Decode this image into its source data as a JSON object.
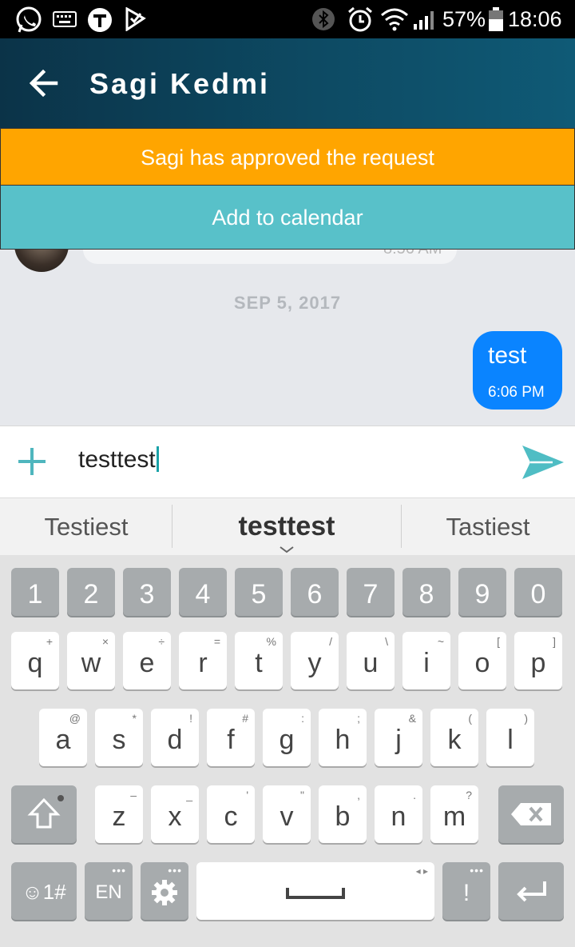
{
  "status_bar": {
    "battery_text": "57%",
    "time": "18:06",
    "icons": [
      "whatsapp-icon",
      "keyboard-icon",
      "app-t-icon",
      "check-flag-icon",
      "bluetooth-icon",
      "alarm-icon",
      "wifi-icon",
      "signal-icon",
      "battery-icon"
    ]
  },
  "header": {
    "title": "Sagi Kedmi",
    "back_icon": "arrow-left-icon",
    "bg": "#0d4a63"
  },
  "banners": {
    "approved": "Sagi has approved the request",
    "approved_color": "#ffa500",
    "calendar": "Add to calendar",
    "calendar_color": "#58c1c9"
  },
  "chat": {
    "previous_time_partial": "8:56 AM",
    "date_separator": "SEP 5, 2017",
    "messages": [
      {
        "text": "test",
        "time": "6:06 PM",
        "sent": true,
        "color": "#0a84ff"
      }
    ]
  },
  "composer": {
    "value": "testtest",
    "plus_icon": "plus-icon",
    "send_icon": "send-icon"
  },
  "keyboard": {
    "suggestions": [
      "Testiest",
      "testtest",
      "Tastiest"
    ],
    "numbers": [
      "1",
      "2",
      "3",
      "4",
      "5",
      "6",
      "7",
      "8",
      "9",
      "0"
    ],
    "row1": [
      {
        "k": "q",
        "h": "+"
      },
      {
        "k": "w",
        "h": "×"
      },
      {
        "k": "e",
        "h": "÷"
      },
      {
        "k": "r",
        "h": "="
      },
      {
        "k": "t",
        "h": "%"
      },
      {
        "k": "y",
        "h": "/"
      },
      {
        "k": "u",
        "h": "\\"
      },
      {
        "k": "i",
        "h": "~"
      },
      {
        "k": "o",
        "h": "["
      },
      {
        "k": "p",
        "h": "]"
      }
    ],
    "row2": [
      {
        "k": "a",
        "h": "@"
      },
      {
        "k": "s",
        "h": "*"
      },
      {
        "k": "d",
        "h": "!"
      },
      {
        "k": "f",
        "h": "#"
      },
      {
        "k": "g",
        "h": ":"
      },
      {
        "k": "h",
        "h": ";"
      },
      {
        "k": "j",
        "h": "&"
      },
      {
        "k": "k",
        "h": "("
      },
      {
        "k": "l",
        "h": ")"
      }
    ],
    "row3": [
      {
        "k": "z",
        "h": "–"
      },
      {
        "k": "x",
        "h": "_"
      },
      {
        "k": "c",
        "h": "'"
      },
      {
        "k": "v",
        "h": "\""
      },
      {
        "k": "b",
        "h": ","
      },
      {
        "k": "n",
        "h": "."
      },
      {
        "k": "m",
        "h": "?"
      }
    ],
    "symbols_label": "☺1#",
    "lang_label": "EN",
    "exclaim_label": "!",
    "space_arrows": "◂ ▸"
  }
}
